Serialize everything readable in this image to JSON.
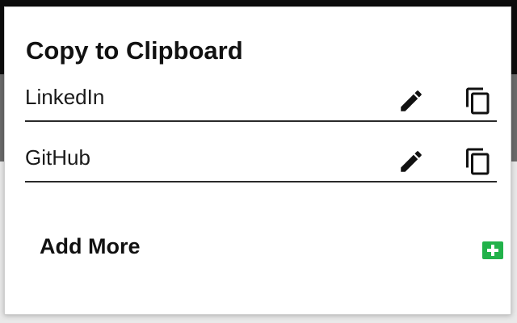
{
  "popup": {
    "title": "Copy to Clipboard",
    "items": [
      {
        "label": "LinkedIn",
        "edit_icon": "pencil-icon",
        "copy_icon": "copy-icon"
      },
      {
        "label": "GitHub",
        "edit_icon": "pencil-icon",
        "copy_icon": "copy-icon"
      }
    ],
    "add_more_label": "Add More",
    "add_icon": "plus-square-icon"
  },
  "colors": {
    "text": "#111111",
    "divider": "#2a2a2a",
    "add_button": "#21b24a",
    "icon": "#111111"
  }
}
